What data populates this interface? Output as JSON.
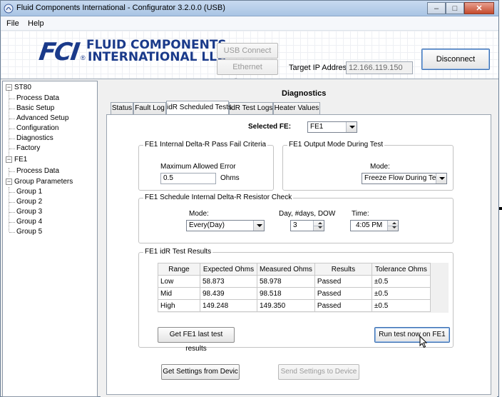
{
  "window": {
    "title": "Fluid Components International - Configurator 3.2.0.0 (USB)",
    "buttons": {
      "minimize": "–",
      "maximize": "□",
      "close": "✕"
    }
  },
  "menu": {
    "file": "File",
    "help": "Help"
  },
  "banner": {
    "logo_mark": "FCI",
    "logo_line1": "FLUID COMPONENTS",
    "logo_line2": "INTERNATIONAL LLC",
    "logo_reg": "®",
    "usb_connect": "USB Connect",
    "ethernet_connect": "Ethernet Connect",
    "target_ip_label": "Target IP Address:",
    "target_ip_value": "12.166.119.150",
    "disconnect": "Disconnect"
  },
  "tree": {
    "st80": "ST80",
    "process_data": "Process Data",
    "basic_setup": "Basic Setup",
    "advanced_setup": "Advanced Setup",
    "configuration": "Configuration",
    "diagnostics": "Diagnostics",
    "factory": "Factory",
    "fe1": "FE1",
    "fe1_process_data": "Process Data",
    "group_parameters": "Group Parameters",
    "group1": "Group 1",
    "group2": "Group 2",
    "group3": "Group 3",
    "group4": "Group 4",
    "group5": "Group 5"
  },
  "main": {
    "heading": "Diagnostics",
    "tabs": [
      {
        "label": "Status"
      },
      {
        "label": "Fault Log"
      },
      {
        "label": "idR Scheduled Tests"
      },
      {
        "label": "idR Test Logs"
      },
      {
        "label": "Heater Values"
      }
    ],
    "selected_fe_label": "Selected FE:",
    "selected_fe_value": "FE1",
    "pass_fail": {
      "title": "FE1 Internal Delta-R Pass Fail Criteria",
      "max_error_label": "Maximum Allowed Error",
      "max_error_value": "0.5",
      "ohms_label": "Ohms"
    },
    "output_mode": {
      "title": "FE1  Output Mode During Test",
      "mode_label": "Mode:",
      "mode_value": "Freeze Flow During Test"
    },
    "schedule": {
      "title": "FE1 Schedule Internal Delta-R Resistor Check",
      "mode_label": "Mode:",
      "mode_value": "Every(Day)",
      "days_label": "Day, #days, DOW",
      "days_value": "3",
      "time_label": "Time:",
      "time_value": "4:05 PM"
    },
    "results": {
      "title": "FE1 idR Test Results",
      "headers": [
        "Range",
        "Expected Ohms",
        "Measured Ohms",
        "Results",
        "Tolerance Ohms"
      ],
      "rows": [
        [
          "Low",
          "58.873",
          "58.978",
          "Passed",
          "±0.5"
        ],
        [
          "Mid",
          "98.439",
          "98.518",
          "Passed",
          "±0.5"
        ],
        [
          "High",
          "149.248",
          "149.350",
          "Passed",
          "±0.5"
        ]
      ],
      "get_last_results": "Get FE1 last test results",
      "run_test": "Run test now on FE1"
    },
    "get_settings": "Get Settings from Devic",
    "send_settings": "Send Settings to Device"
  }
}
